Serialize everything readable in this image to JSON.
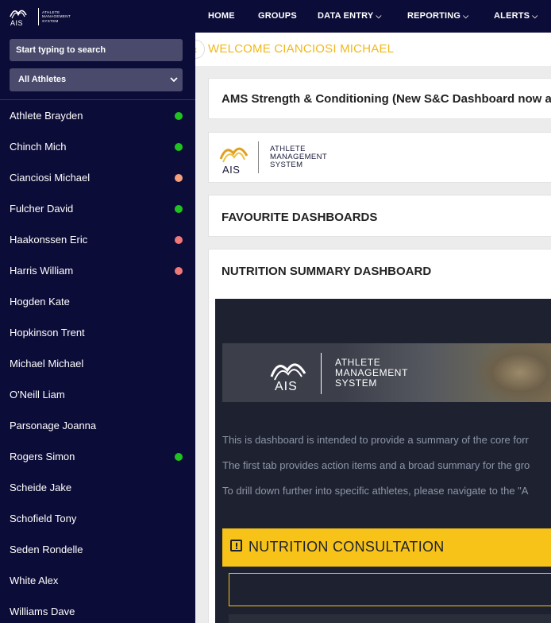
{
  "brand": {
    "mark_text": "AIS",
    "wordmark_lines": [
      "ATHLETE",
      "MANAGEMENT",
      "SYSTEM"
    ]
  },
  "sidebar": {
    "search_placeholder": "Start typing to search",
    "filter_selected": "All Athletes",
    "athletes": [
      {
        "name": "Athlete Brayden",
        "status": "#1fc31f"
      },
      {
        "name": "Chinch Mich",
        "status": "#1fc31f"
      },
      {
        "name": "Cianciosi Michael",
        "status": "#f5a07a"
      },
      {
        "name": "Fulcher David",
        "status": "#1fc31f"
      },
      {
        "name": "Haakonssen Eric",
        "status": "#f07878"
      },
      {
        "name": "Harris William",
        "status": "#f07878"
      },
      {
        "name": "Hogden Kate",
        "status": ""
      },
      {
        "name": "Hopkinson Trent",
        "status": ""
      },
      {
        "name": "Michael Michael",
        "status": ""
      },
      {
        "name": "O'Neill Liam",
        "status": ""
      },
      {
        "name": "Parsonage Joanna",
        "status": ""
      },
      {
        "name": "Rogers Simon",
        "status": "#1fc31f"
      },
      {
        "name": "Scheide Jake",
        "status": ""
      },
      {
        "name": "Schofield Tony",
        "status": ""
      },
      {
        "name": "Seden Rondelle",
        "status": ""
      },
      {
        "name": "White Alex",
        "status": ""
      },
      {
        "name": "Williams Dave",
        "status": ""
      }
    ]
  },
  "nav": {
    "items": [
      {
        "label": "HOME",
        "dropdown": false
      },
      {
        "label": "GROUPS",
        "dropdown": false
      },
      {
        "label": "DATA ENTRY",
        "dropdown": true
      },
      {
        "label": "REPORTING",
        "dropdown": true
      },
      {
        "label": "ALERTS",
        "dropdown": true
      }
    ]
  },
  "main": {
    "welcome": "WELCOME CIANCIOSI MICHAEL",
    "announcement": "AMS Strength & Conditioning (New S&C Dashboard now av",
    "ams_logo": {
      "mark_text": "AIS",
      "lines": [
        "ATHLETE",
        "MANAGEMENT",
        "SYSTEM"
      ]
    },
    "favourites_title": "FAVOURITE DASHBOARDS",
    "nutrition_title": "NUTRITION SUMMARY DASHBOARD",
    "banner": {
      "mark_text": "AIS",
      "lines": [
        "ATHLETE",
        "MANAGEMENT",
        "SYSTEM"
      ]
    },
    "dashboard_text": [
      "This is dashboard is intended to provide a summary of the core forr",
      "The first tab provides action items and a broad summary for the gro",
      "To drill down further into specific athletes, please navigate to the \"A"
    ],
    "consultation_title": "NUTRITION CONSULTATION"
  },
  "colors": {
    "sidebar_bg": "#0c0c38",
    "accent_yellow": "#f7c318",
    "welcome_text": "#f0b81a"
  }
}
